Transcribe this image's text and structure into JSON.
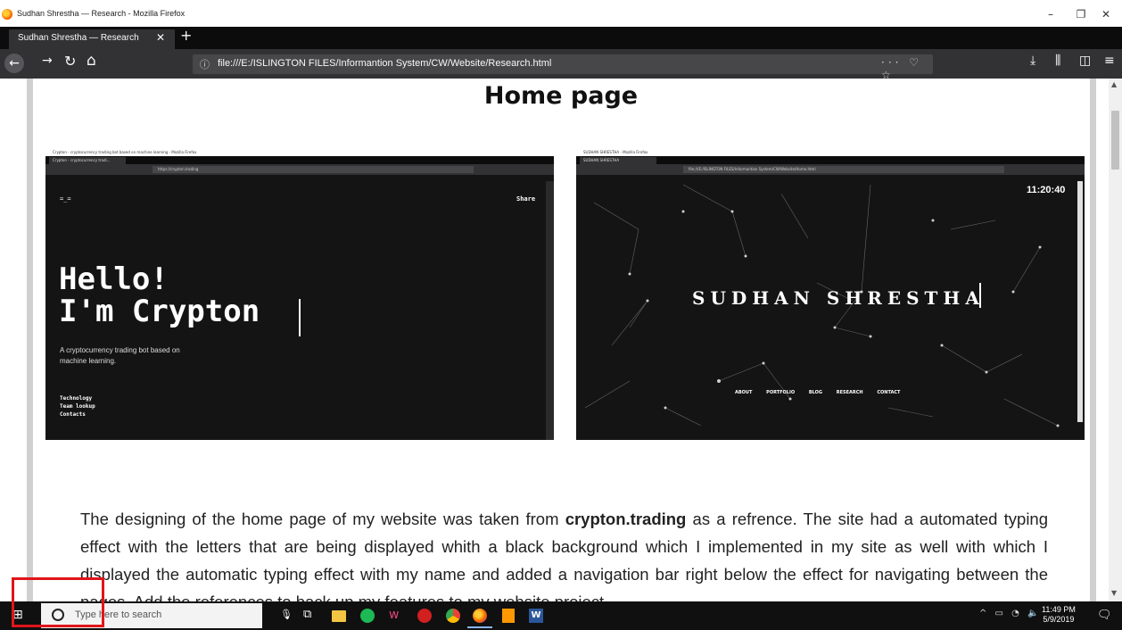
{
  "window": {
    "title": "Sudhan Shrestha — Research - Mozilla Firefox",
    "minimize": "–",
    "maximize": "❐",
    "close": "✕"
  },
  "tab": {
    "label": "Sudhan Shrestha — Research",
    "close": "✕",
    "new_tab": "+"
  },
  "nav": {
    "back": "←",
    "forward": "→",
    "reload": "↻",
    "home": "⌂",
    "info": "ⓘ",
    "url": "file:///E:/ISLINGTON FILES/Informantion System/CW/Website/Research.html",
    "page_actions": "··· ♡ ☆",
    "download": "⤓",
    "library": "⫼",
    "sidebar": "◫",
    "menu": "≡"
  },
  "page": {
    "heading": "Home page",
    "shot1": {
      "title": "Crypton - cryptocurrency trading bot based on machine learning - Mozilla Firefox",
      "tab": "Crypton - cryptocurrency tradi...",
      "url": "https://crypton.trading",
      "logo": "=_=",
      "share": "Share",
      "hello_line1": "Hello!",
      "hello_line2": "I'm Crypton",
      "subtitle": "A cryptocurrency trading bot based on machine learning.",
      "menu": [
        "Technology",
        "Team lookup",
        "Contacts"
      ]
    },
    "shot2": {
      "title": "SUDHAN SHRESTHA - Mozilla Firefox",
      "tab": "SUDHAN SHRESTHA",
      "url": "file:///E:/ISLINGTON FILES/Informantion System/CW/Website/Home.html",
      "clock": "11:20:40",
      "name": "SUDHAN SHRESTHA",
      "nav_links": [
        "ABOUT",
        "PORTFOLIO",
        "BLOG",
        "RESEARCH",
        "CONTACT"
      ]
    },
    "paragraph_before": "The designing of the home page of my website was taken from ",
    "paragraph_bold": "crypton.trading",
    "paragraph_after": " as a refrence. The site had a automated typing effect with the letters that are being displayed whith a black background which I implemented in my site as well with which I displayed the automatic typing effect with my name and added a navigation bar right below the effect for navigating between the pages. Add the references to back up my features to my website project"
  },
  "taskbar": {
    "start": "⊞",
    "search_placeholder": "Type here to search",
    "mic": "🎙",
    "apps": [
      "task-view",
      "file-explorer",
      "spotify",
      "app",
      "game",
      "chrome",
      "firefox",
      "sublime",
      "word"
    ],
    "tray": "^ ▭ ◔ 🔈",
    "time": "11:49 PM",
    "date": "5/9/2019",
    "notifications": "🗨"
  }
}
